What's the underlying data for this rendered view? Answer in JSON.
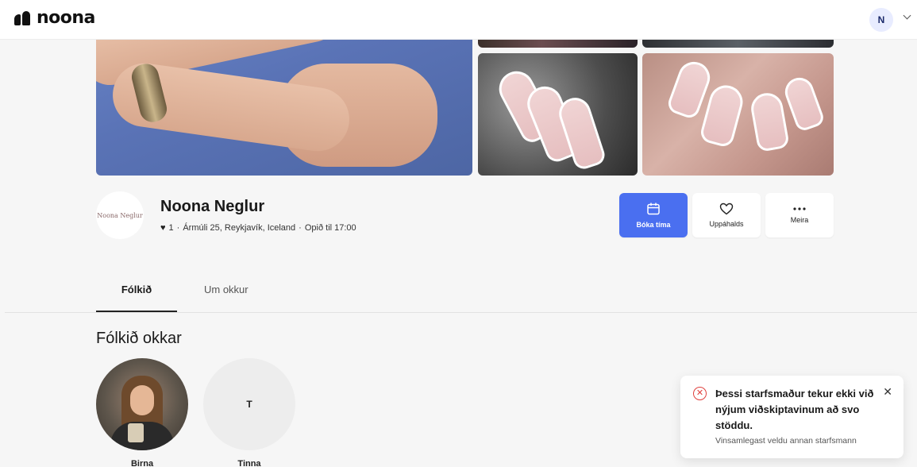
{
  "header": {
    "logo_text": "noona",
    "avatar_initial": "N"
  },
  "business": {
    "name": "Noona Neglur",
    "logo_text": "Noona Neglur",
    "likes": "1",
    "address": "Ármúli 25, Reykjavík, Iceland",
    "hours": "Opið til 17:00",
    "separator": "·"
  },
  "actions": {
    "book_label": "Bóka tíma",
    "favorite_label": "Uppáhalds",
    "more_label": "Meira",
    "book_color": "#4a6ff0"
  },
  "tabs": [
    {
      "label": "Fólkið",
      "active": true
    },
    {
      "label": "Um okkur",
      "active": false
    }
  ],
  "people_section": {
    "title": "Fólkið okkar",
    "people": [
      {
        "name": "Birna",
        "initial": ""
      },
      {
        "name": "Tinna",
        "initial": "T"
      }
    ]
  },
  "toast": {
    "title": "Þessi starfsmaður tekur ekki við nýjum viðskiptavinum að svo stöddu.",
    "message": "Vinsamlegast veldu annan starfsmann",
    "error_color": "#e0403d"
  }
}
